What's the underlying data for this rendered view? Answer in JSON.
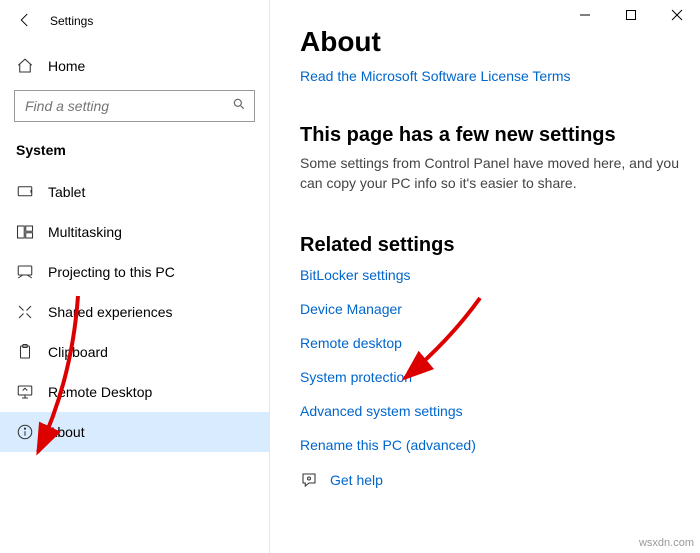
{
  "titlebar": {
    "back": "←",
    "title": "Settings"
  },
  "win": {
    "min": "—",
    "max": "▢",
    "close": "✕"
  },
  "home": {
    "label": "Home"
  },
  "search": {
    "placeholder": "Find a setting"
  },
  "section": "System",
  "nav": {
    "tablet": "Tablet",
    "multitasking": "Multitasking",
    "projecting": "Projecting to this PC",
    "shared": "Shared experiences",
    "clipboard": "Clipboard",
    "remote": "Remote Desktop",
    "about": "About"
  },
  "page": {
    "title": "About",
    "license_link": "Read the Microsoft Software License Terms",
    "subhead": "This page has a few new settings",
    "body1": "Some settings from Control Panel have moved here, and you can copy your PC info so it's easier to share.",
    "related": "Related settings",
    "links": {
      "bitlocker": "BitLocker settings",
      "devicemgr": "Device Manager",
      "remote": "Remote desktop",
      "sysprotect": "System protection",
      "advanced": "Advanced system settings",
      "rename": "Rename this PC (advanced)"
    },
    "help": "Get help"
  },
  "watermark": "wsxdn.com"
}
